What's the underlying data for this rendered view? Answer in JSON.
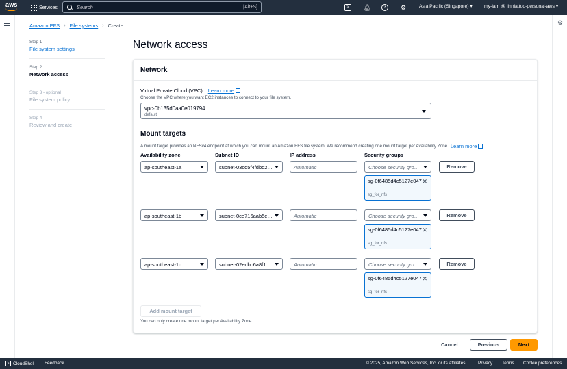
{
  "topnav": {
    "logo_text": "aws",
    "services_label": "Services",
    "search_placeholder": "Search",
    "search_shortcut": "[Alt+S]",
    "region": "Asia Pacific (Singapore) ▾",
    "account": "my-iam @ linnlattoo-personal-aws ▾"
  },
  "breadcrumb": {
    "items": [
      "Amazon EFS",
      "File systems",
      "Create"
    ]
  },
  "steps": [
    {
      "num": "Step 1",
      "label": "File system settings"
    },
    {
      "num": "Step 2",
      "label": "Network access"
    },
    {
      "num": "Step 3 - optional",
      "label": "File system policy"
    },
    {
      "num": "Step 4",
      "label": "Review and create"
    }
  ],
  "page_title": "Network access",
  "panel": {
    "heading": "Network",
    "vpc_label": "Virtual Private Cloud (VPC)",
    "learn_more": "Learn more",
    "vpc_description": "Choose the VPC where you want EC2 instances to connect to your file system.",
    "vpc_value": "vpc-0b135d0aa0e019794",
    "vpc_sub": "default",
    "mount_title": "Mount targets",
    "mount_description": "A mount target provides an NFSv4 endpoint at which you can mount an Amazon EFS file system. We recommend creating one mount target per Availability Zone.",
    "columns": [
      "Availability zone",
      "Subnet ID",
      "IP address",
      "Security groups"
    ],
    "rows": [
      {
        "az": "ap-southeast-1a",
        "subnet": "subnet-03cd5f4fdbd2f1c21",
        "ip_placeholder": "Automatic",
        "sg_placeholder": "Choose security groups",
        "sg_id": "sg-0f6485d4c5127e047",
        "sg_name": "sg_for_nfs",
        "remove": "Remove"
      },
      {
        "az": "ap-southeast-1b",
        "subnet": "subnet-0ce716aab5ec98b81",
        "ip_placeholder": "Automatic",
        "sg_placeholder": "Choose security groups",
        "sg_id": "sg-0f6485d4c5127e047",
        "sg_name": "sg_for_nfs",
        "remove": "Remove"
      },
      {
        "az": "ap-southeast-1c",
        "subnet": "subnet-02edbc6a8f1e3b1d9",
        "ip_placeholder": "Automatic",
        "sg_placeholder": "Choose security groups",
        "sg_id": "sg-0f6485d4c5127e047",
        "sg_name": "sg_for_nfs",
        "remove": "Remove"
      }
    ],
    "add_button": "Add mount target",
    "add_note": "You can only create one mount target per Availability Zone."
  },
  "actions": {
    "cancel": "Cancel",
    "previous": "Previous",
    "next": "Next"
  },
  "bottombar": {
    "cloudshell": "CloudShell",
    "feedback": "Feedback",
    "copyright": "© 2025, Amazon Web Services, Inc. or its affiliates.",
    "privacy": "Privacy",
    "terms": "Terms",
    "cookie": "Cookie preferences"
  },
  "colors": {
    "nav_bg": "#232f3e",
    "link": "#0972d3",
    "primary": "#ff9900",
    "token_bg": "#f2f8fd"
  }
}
